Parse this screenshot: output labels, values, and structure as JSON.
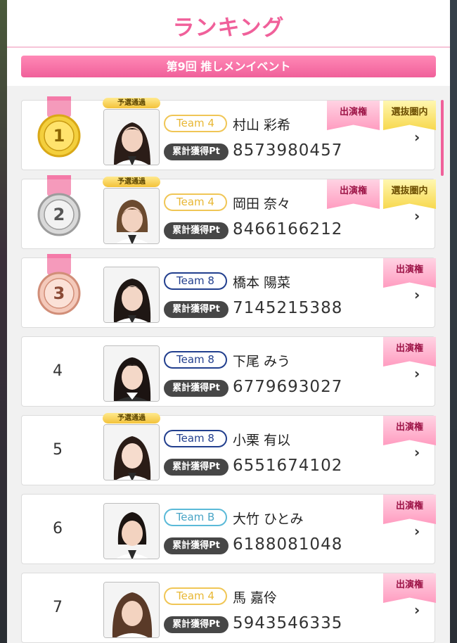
{
  "header": {
    "title": "ランキング",
    "event": "第9回 推しメンイベント"
  },
  "labels": {
    "qualify_badge": "予選通過",
    "pt_label": "累計獲得Pt",
    "tag_appearance": "出演権",
    "tag_selection": "選抜圏内"
  },
  "colors": {
    "accent": "#f0609a",
    "team_4": "#e8b734",
    "team_8": "#223f8e",
    "team_b": "#4aa5c6"
  },
  "rows": [
    {
      "rank": "1",
      "medal": "gold",
      "team": "Team 4",
      "name": "村山 彩希",
      "points": "8573980457",
      "qualified": true,
      "tags": [
        "出演権",
        "選抜圏内"
      ]
    },
    {
      "rank": "2",
      "medal": "silver",
      "team": "Team 4",
      "name": "岡田 奈々",
      "points": "8466166212",
      "qualified": true,
      "tags": [
        "出演権",
        "選抜圏内"
      ]
    },
    {
      "rank": "3",
      "medal": "bronze",
      "team": "Team 8",
      "name": "橋本 陽菜",
      "points": "7145215388",
      "qualified": false,
      "tags": [
        "出演権"
      ]
    },
    {
      "rank": "4",
      "medal": null,
      "team": "Team 8",
      "name": "下尾 みう",
      "points": "6779693027",
      "qualified": false,
      "tags": [
        "出演権"
      ]
    },
    {
      "rank": "5",
      "medal": null,
      "team": "Team 8",
      "name": "小栗 有以",
      "points": "6551674102",
      "qualified": true,
      "tags": [
        "出演権"
      ]
    },
    {
      "rank": "6",
      "medal": null,
      "team": "Team B",
      "name": "大竹 ひとみ",
      "points": "6188081048",
      "qualified": false,
      "tags": [
        "出演権"
      ]
    },
    {
      "rank": "7",
      "medal": null,
      "team": "Team 4",
      "name": "馬 嘉伶",
      "points": "5943546335",
      "qualified": false,
      "tags": [
        "出演権"
      ]
    }
  ]
}
